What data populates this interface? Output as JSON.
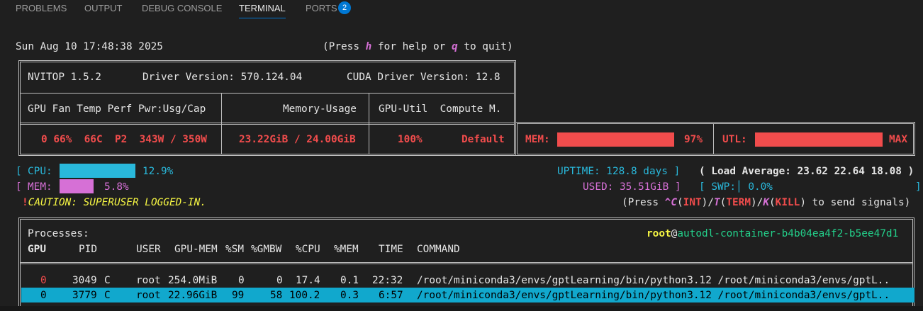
{
  "panel_tabs": [
    {
      "label": "PROBLEMS"
    },
    {
      "label": "OUTPUT"
    },
    {
      "label": "DEBUG CONSOLE"
    },
    {
      "label": "TERMINAL"
    },
    {
      "label": "PORTS"
    }
  ],
  "ports_badge": "2",
  "clock": "Sun Aug 10 17:48:38 2025",
  "help": {
    "press": "(Press ",
    "h": "h",
    "for_help": " for help or ",
    "q": "q",
    "to_quit": " to quit)"
  },
  "header": {
    "nvitop": "NVITOP 1.5.2",
    "driver": "Driver Version: 570.124.04",
    "cuda": "CUDA Driver Version: 12.8",
    "col_gpu": "GPU Fan Temp Perf Pwr:Usg/Cap",
    "col_mem": "Memory-Usage",
    "col_util": "GPU-Util  Compute M."
  },
  "gpu": {
    "stats": "0 66%  66C  P2  343W / 350W",
    "memory": "23.22GiB / 24.00GiB",
    "util": "100%",
    "compute_mode": "Default",
    "mem_label": "MEM:",
    "mem_pct": "97%",
    "mem_fraction": 0.97,
    "utl_label": "UTL:",
    "utl_value": "MAX",
    "utl_fraction": 1.0
  },
  "host": {
    "cpu_label": "CPU:",
    "cpu_value": "12.9%",
    "cpu_fraction": 0.129,
    "mem_label": "MEM:",
    "mem_value": "5.8%",
    "mem_fraction": 0.058,
    "uptime": "UPTIME: 128.8 days",
    "load": "Load Average: 23.62 22.64 18.08",
    "used": "USED: 35.51GiB",
    "swp_label": "SWP:",
    "swp_value": "0.0%",
    "caution": "CAUTION: SUPERUSER LOGGED-IN.",
    "signals": {
      "press": "(Press ",
      "c": "^C",
      "int": "INT",
      "t": "T",
      "term": "TERM",
      "k": "K",
      "kill": "KILL",
      "end": " to send signals)"
    }
  },
  "processes": {
    "title": "Processes:",
    "user": "root",
    "host": "autodl-container-b4b04ea4f2-b5ee47d1",
    "columns": [
      "GPU",
      "PID",
      "USER",
      "GPU-MEM",
      "%SM",
      "%GMBW",
      "%CPU",
      "%MEM",
      "TIME",
      "COMMAND"
    ],
    "rows": [
      {
        "gpu": "0",
        "pid": "3049",
        "type": "C",
        "user": "root",
        "gpu_mem": "254.0MiB",
        "sm": "0",
        "gmbw": "0",
        "cpu": "17.4",
        "mem": "0.1",
        "time": "22:32",
        "command": "/root/miniconda3/envs/gptLearning/bin/python3.12 /root/miniconda3/envs/gptL.."
      },
      {
        "gpu": "0",
        "pid": "3779",
        "type": "C",
        "user": "root",
        "gpu_mem": "22.96GiB",
        "sm": "99",
        "gmbw": "58",
        "cpu": "100.2",
        "mem": "0.3",
        "time": "6:57",
        "command": "/root/miniconda3/envs/gptLearning/bin/python3.12 /root/miniconda3/envs/gptL.."
      }
    ]
  },
  "colors": {
    "accent": "#0078d4",
    "red": "#f14c4c",
    "cyan": "#29b8db",
    "magenta": "#d670d6",
    "yellow": "#f5f543",
    "green": "#23d18b",
    "highlight": "#11a8cd"
  }
}
